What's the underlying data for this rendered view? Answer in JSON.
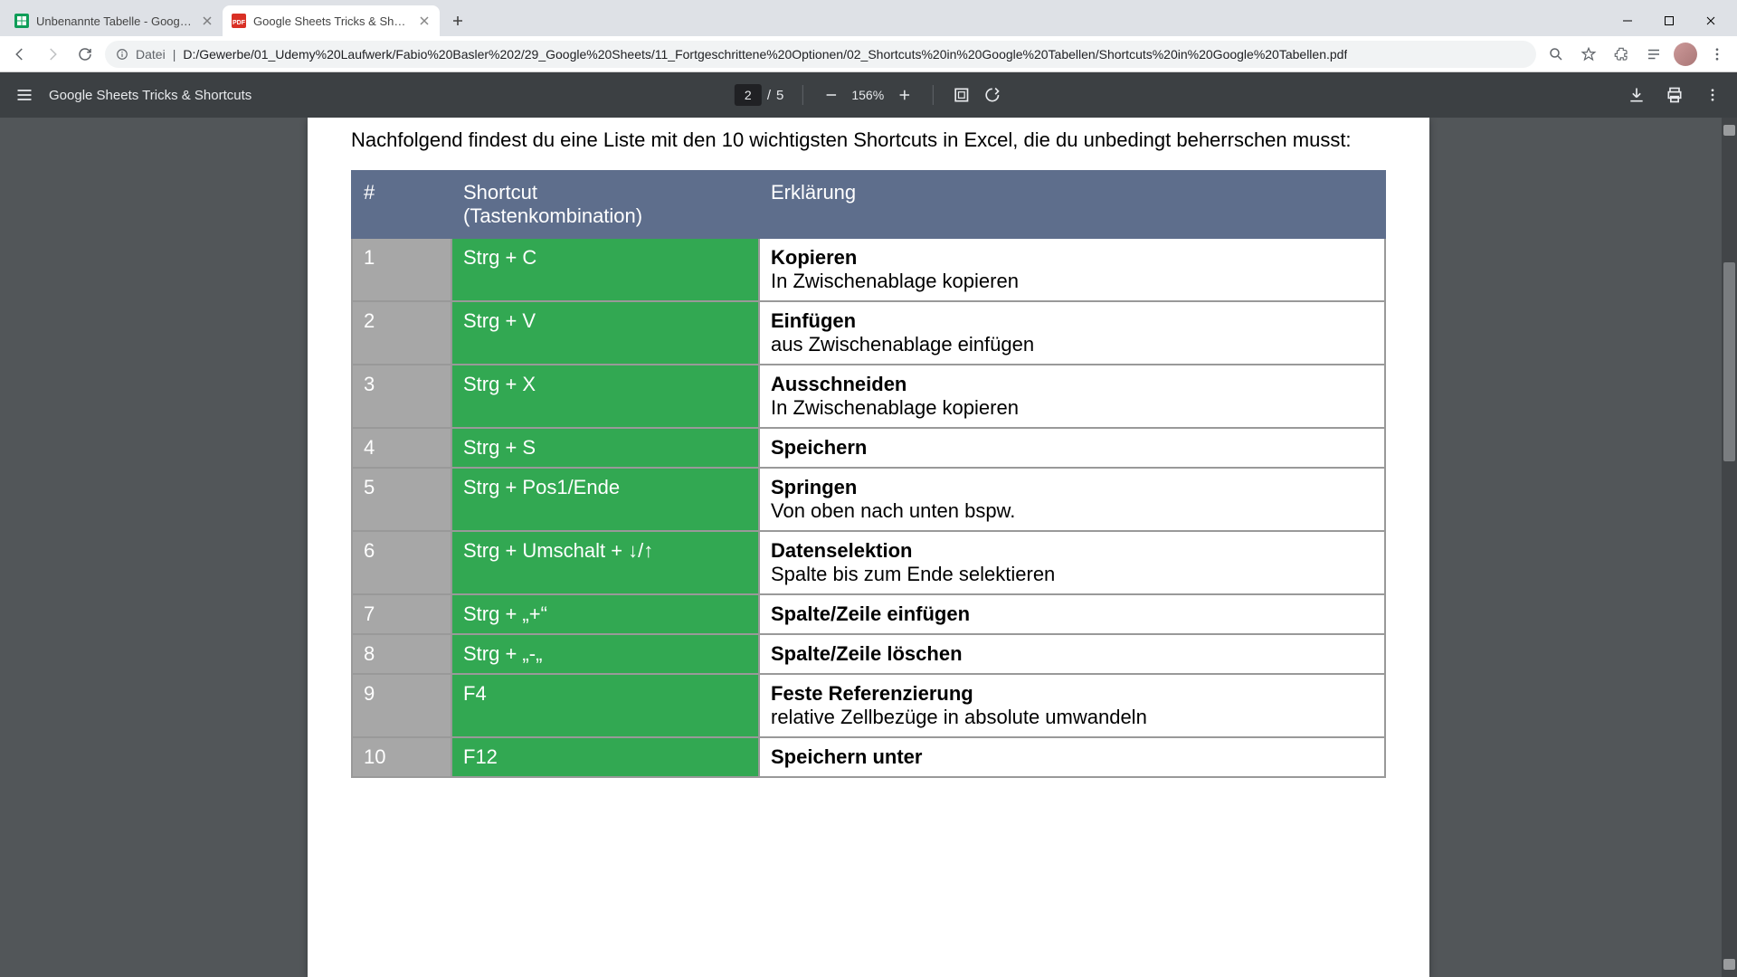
{
  "tabs": [
    {
      "title": "Unbenannte Tabelle - Google Ta",
      "active": false,
      "favicon": "sheets"
    },
    {
      "title": "Google Sheets Tricks & Shortcuts",
      "active": true,
      "favicon": "pdf"
    }
  ],
  "address": {
    "scheme_label": "Datei",
    "path": "D:/Gewerbe/01_Udemy%20Laufwerk/Fabio%20Basler%202/29_Google%20Sheets/11_Fortgeschrittene%20Optionen/02_Shortcuts%20in%20Google%20Tabellen/Shortcuts%20in%20Google%20Tabellen.pdf"
  },
  "pdf": {
    "doc_title": "Google Sheets Tricks & Shortcuts",
    "page_current": "2",
    "page_total": "5",
    "page_sep": "/",
    "zoom": "156%"
  },
  "content": {
    "intro": "Nachfolgend findest du eine Liste mit den 10 wichtigsten Shortcuts in Excel, die du unbedingt beherrschen musst:",
    "headers": {
      "num": "#",
      "shortcut": "Shortcut\n(Tastenkombination)",
      "explain": "Erklärung"
    },
    "rows": [
      {
        "n": "1",
        "sc": "Strg + C",
        "t": "Kopieren",
        "d": "In Zwischenablage kopieren"
      },
      {
        "n": "2",
        "sc": "Strg + V",
        "t": "Einfügen",
        "d": "aus Zwischenablage einfügen"
      },
      {
        "n": "3",
        "sc": "Strg + X",
        "t": "Ausschneiden",
        "d": "In Zwischenablage kopieren"
      },
      {
        "n": "4",
        "sc": "Strg + S",
        "t": "Speichern",
        "d": ""
      },
      {
        "n": "5",
        "sc": "Strg + Pos1/Ende",
        "t": "Springen",
        "d": "Von oben nach unten bspw."
      },
      {
        "n": "6",
        "sc": "Strg + Umschalt + ↓/↑",
        "t": "Datenselektion",
        "d": "Spalte bis zum Ende selektieren"
      },
      {
        "n": "7",
        "sc": "Strg + „+“",
        "t": "Spalte/Zeile einfügen",
        "d": ""
      },
      {
        "n": "8",
        "sc": "Strg + „-„",
        "t": "Spalte/Zeile löschen",
        "d": ""
      },
      {
        "n": "9",
        "sc": "F4",
        "t": "Feste Referenzierung",
        "d": "relative Zellbezüge in absolute umwandeln"
      },
      {
        "n": "10",
        "sc": "F12",
        "t": "Speichern unter",
        "d": ""
      }
    ]
  }
}
